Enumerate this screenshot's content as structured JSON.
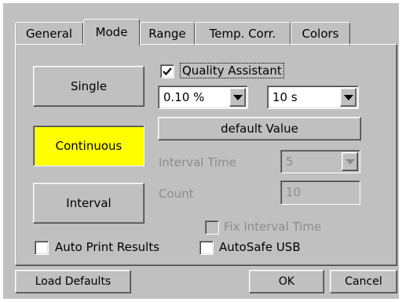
{
  "tabs": [
    "General",
    "Mode",
    "Range",
    "Temp. Corr.",
    "Colors"
  ],
  "mode": {
    "single": "Single",
    "continuous": "Continuous",
    "interval": "Interval",
    "quality_assistant": "Quality Assistant",
    "tolerance_value": "0.10 %",
    "time_value": "10 s",
    "default_value": "default Value",
    "interval_time_label": "Interval Time",
    "interval_time_value": "5",
    "count_label": "Count",
    "count_value": "10",
    "fix_interval_time": "Fix Interval Time",
    "auto_print_results": "Auto Print Results",
    "autosafe_usb": "AutoSafe USB"
  },
  "footer": {
    "load_defaults": "Load Defaults",
    "ok": "OK",
    "cancel": "Cancel"
  },
  "colors": {
    "face": "#c0c0c0",
    "active_mode": "#ffff00",
    "disabled_text": "#8c8c8c"
  }
}
